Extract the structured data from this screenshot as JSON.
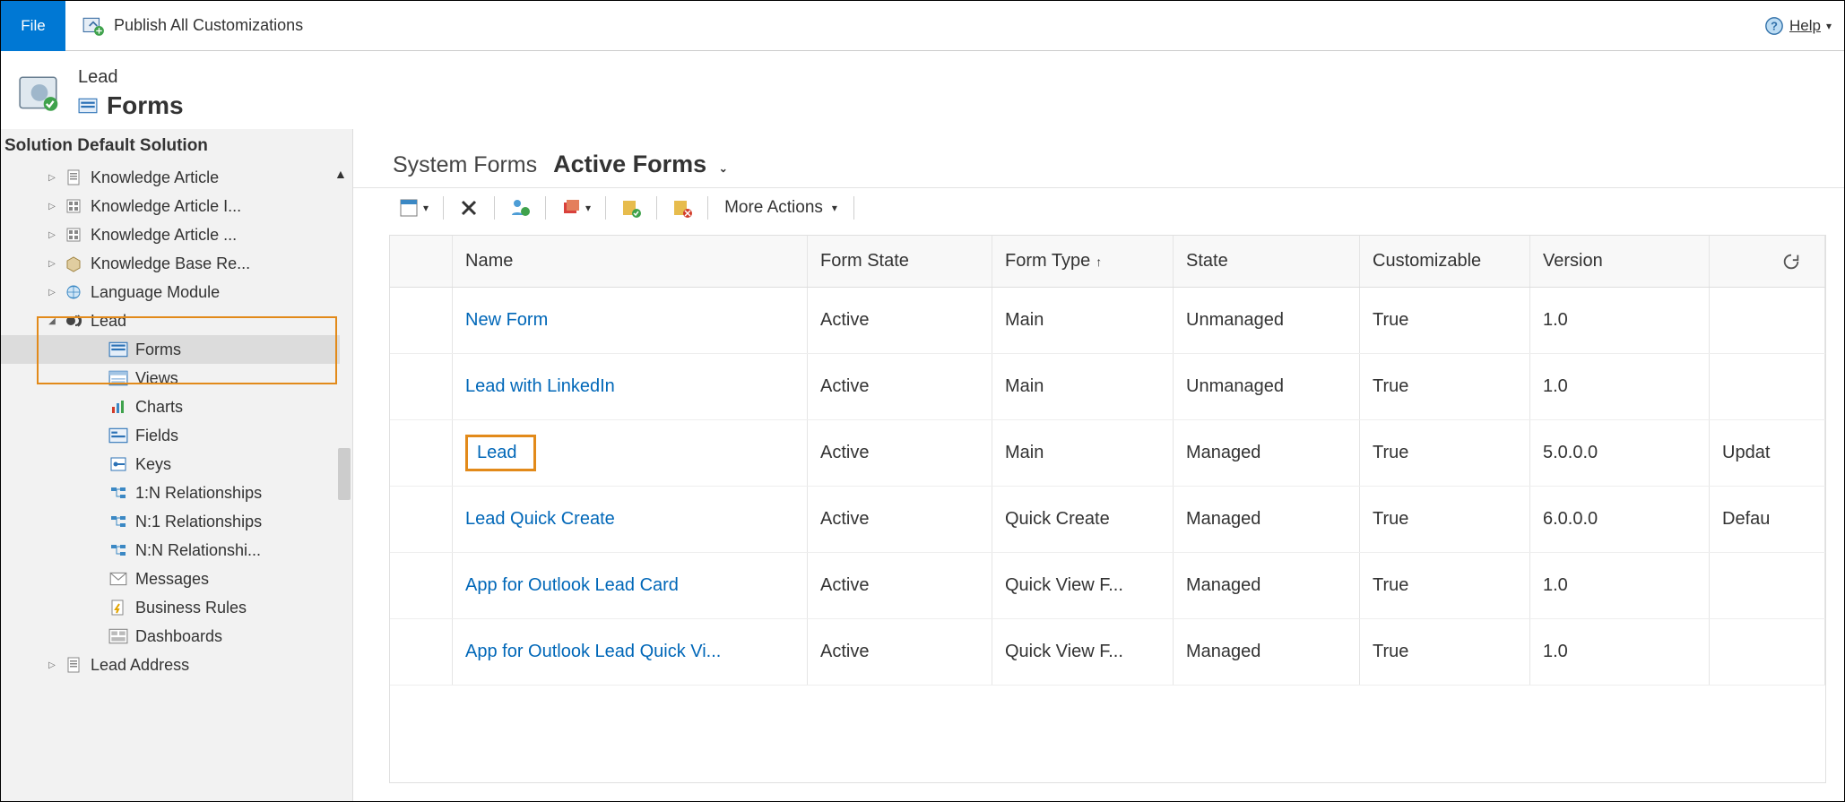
{
  "topbar": {
    "file_label": "File",
    "publish_all_label": "Publish All Customizations",
    "help_label": "Help"
  },
  "header": {
    "entity_name": "Lead",
    "page_title": "Forms"
  },
  "sidebar": {
    "solution_label": "Solution Default Solution",
    "items": [
      {
        "label": "Knowledge Article",
        "icon": "doc"
      },
      {
        "label": "Knowledge Article I...",
        "icon": "doc-grid"
      },
      {
        "label": "Knowledge Article ...",
        "icon": "doc-grid"
      },
      {
        "label": "Knowledge Base Re...",
        "icon": "box"
      },
      {
        "label": "Language Module",
        "icon": "lang"
      },
      {
        "label": "Lead",
        "icon": "lead",
        "expanded": true
      },
      {
        "label": "Lead Address",
        "icon": "doc"
      }
    ],
    "lead_children": [
      {
        "label": "Forms",
        "icon": "form",
        "selected": true
      },
      {
        "label": "Views",
        "icon": "view"
      },
      {
        "label": "Charts",
        "icon": "chart"
      },
      {
        "label": "Fields",
        "icon": "field"
      },
      {
        "label": "Keys",
        "icon": "key"
      },
      {
        "label": "1:N Relationships",
        "icon": "rel"
      },
      {
        "label": "N:1 Relationships",
        "icon": "rel"
      },
      {
        "label": "N:N Relationshi...",
        "icon": "rel"
      },
      {
        "label": "Messages",
        "icon": "msg"
      },
      {
        "label": "Business Rules",
        "icon": "brule"
      },
      {
        "label": "Dashboards",
        "icon": "dash"
      }
    ]
  },
  "view": {
    "system_forms_label": "System Forms",
    "active_forms_label": "Active Forms"
  },
  "toolbar": {
    "more_actions_label": "More Actions"
  },
  "columns": {
    "name": "Name",
    "form_state": "Form State",
    "form_type": "Form Type",
    "state": "State",
    "customizable": "Customizable",
    "version": "Version"
  },
  "rows": [
    {
      "name": "New Form",
      "form_state": "Active",
      "form_type": "Main",
      "state": "Unmanaged",
      "customizable": "True",
      "version": "1.0",
      "desc": ""
    },
    {
      "name": "Lead with LinkedIn",
      "form_state": "Active",
      "form_type": "Main",
      "state": "Unmanaged",
      "customizable": "True",
      "version": "1.0",
      "desc": ""
    },
    {
      "name": "Lead",
      "form_state": "Active",
      "form_type": "Main",
      "state": "Managed",
      "customizable": "True",
      "version": "5.0.0.0",
      "desc": "Updat",
      "highlight": true
    },
    {
      "name": "Lead Quick Create",
      "form_state": "Active",
      "form_type": "Quick Create",
      "state": "Managed",
      "customizable": "True",
      "version": "6.0.0.0",
      "desc": "Defau"
    },
    {
      "name": "App for Outlook Lead Card",
      "form_state": "Active",
      "form_type": "Quick View F...",
      "state": "Managed",
      "customizable": "True",
      "version": "1.0",
      "desc": ""
    },
    {
      "name": "App for Outlook Lead Quick Vi...",
      "form_state": "Active",
      "form_type": "Quick View F...",
      "state": "Managed",
      "customizable": "True",
      "version": "1.0",
      "desc": ""
    }
  ]
}
